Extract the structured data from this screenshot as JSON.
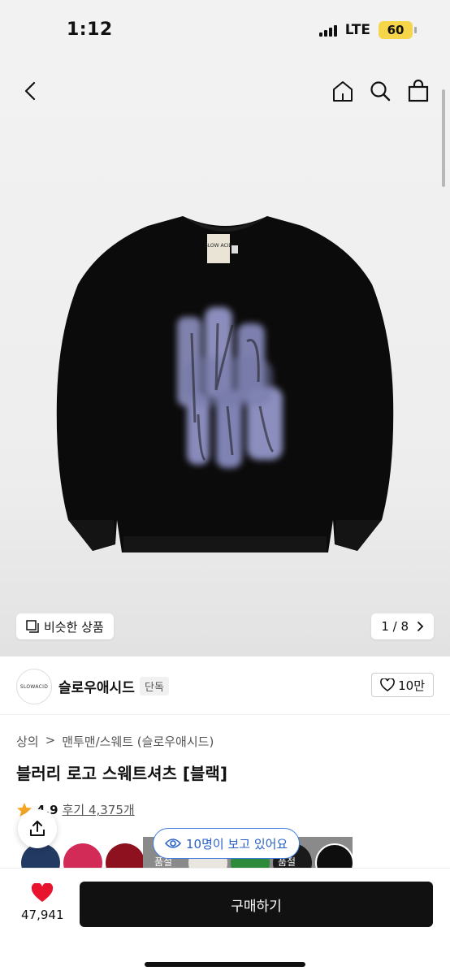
{
  "status": {
    "time": "1:12",
    "network": "LTE",
    "battery": "60"
  },
  "nav": {
    "icons": [
      "back-icon",
      "home-icon",
      "search-icon",
      "shopping-bag-icon"
    ]
  },
  "hero": {
    "image": "black sweatshirt with blurred lavender logo print",
    "tag_text": "SLOW ACID",
    "similar_label": "비슷한 상품",
    "pager": "1 / 8"
  },
  "brand": {
    "name": "슬로우애시드",
    "badge": "단독",
    "logo_text": "SLOWACID",
    "likes": "10만"
  },
  "breadcrumb": {
    "category": "상의",
    "sep": ">",
    "subcategory": "맨투맨/스웨트 (슬로우애시드)"
  },
  "product": {
    "title": "블러리 로고 스웨트셔츠 [블랙]",
    "rating": "4.9",
    "reviews": "후기 4,375개"
  },
  "swatches": {
    "labels": [
      "품절",
      "품절"
    ]
  },
  "viewers": "10명이 보고 있어요",
  "bottom": {
    "like_count": "47,941",
    "buy_label": "구매하기"
  },
  "colors": {
    "accent_blue": "#3d7be0",
    "heart_red": "#e8142d",
    "star": "#f5a623",
    "button": "#111111"
  }
}
